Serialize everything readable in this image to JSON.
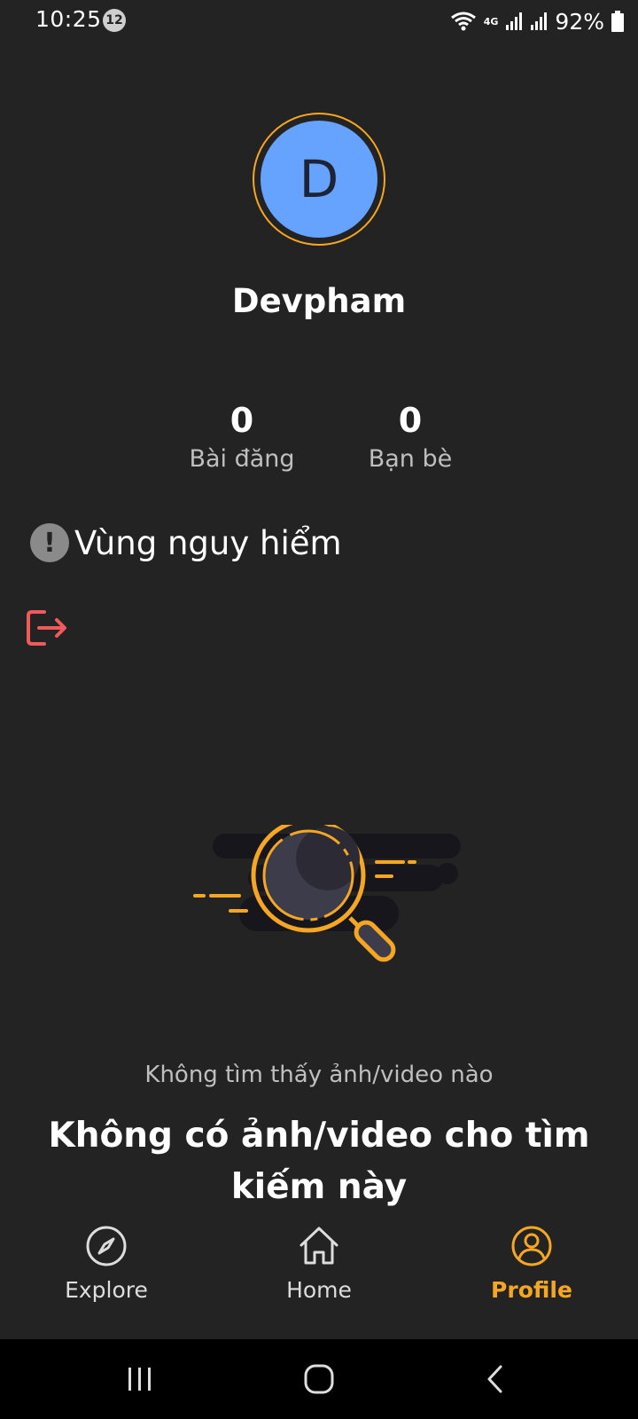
{
  "status_bar": {
    "time": "10:25",
    "notification_count": "12",
    "network": "4G",
    "battery": "92%"
  },
  "profile": {
    "avatar_initial": "D",
    "name": "Devpham",
    "stats": {
      "posts_count": "0",
      "posts_label": "Bài đăng",
      "friends_count": "0",
      "friends_label": "Bạn bè"
    },
    "danger_zone_label": "Vùng nguy hiểm"
  },
  "empty_state": {
    "subtitle": "Không tìm thấy ảnh/video nào",
    "title": "Không có ảnh/video cho tìm kiếm này"
  },
  "bottom_nav": {
    "items": [
      {
        "label": "Explore",
        "icon": "compass-icon",
        "active": false
      },
      {
        "label": "Home",
        "icon": "home-icon",
        "active": false
      },
      {
        "label": "Profile",
        "icon": "user-circle-icon",
        "active": true
      }
    ]
  },
  "colors": {
    "background": "#232323",
    "accent": "#f5a623",
    "avatar_bg": "#66a3ff",
    "danger": "#f05a5a"
  }
}
